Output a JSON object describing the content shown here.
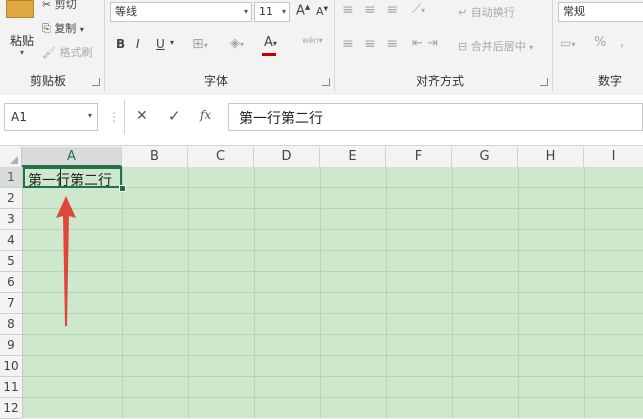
{
  "clipboard": {
    "cut": "剪切",
    "copy": "复制",
    "format_painter": "格式刷",
    "paste": "粘贴",
    "group": "剪贴板"
  },
  "font": {
    "name": "等线",
    "size": "11",
    "bold": "B",
    "italic": "I",
    "underline": "U",
    "grow": "A",
    "shrink": "A",
    "color_letter": "A",
    "wen": "wén",
    "group": "字体"
  },
  "alignment": {
    "wrap_text": "自动换行",
    "merge_center": "合并后居中",
    "group": "对齐方式"
  },
  "number": {
    "format": "常规",
    "percent": "%",
    "comma": ",",
    "group": "数字"
  },
  "formula_bar": {
    "name_box": "A1",
    "cancel": "✕",
    "enter": "✓",
    "fx": "fx",
    "content": "第一行第二行"
  },
  "columns": [
    "A",
    "B",
    "C",
    "D",
    "E",
    "F",
    "G",
    "H",
    "I"
  ],
  "rows": [
    "1",
    "2",
    "3",
    "4",
    "5",
    "6",
    "7",
    "8",
    "9",
    "10",
    "11",
    "12"
  ],
  "cells": {
    "A1": "第一行第二行"
  },
  "colors": {
    "selection": "#217346",
    "sheet_fill": "#cde8cd",
    "arrow": "#e0473a",
    "font_color_bar": "#c00000"
  }
}
